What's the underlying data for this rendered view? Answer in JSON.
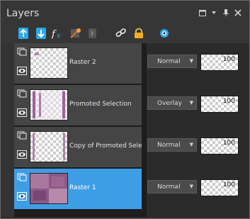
{
  "panel": {
    "title": "Layers"
  },
  "window_buttons": [
    "maximize-icon",
    "dropdown-icon",
    "pin-icon",
    "close-icon"
  ],
  "toolbar": {
    "icons": [
      "new-raster-layer-icon",
      "merge-down-icon",
      "fx-effects-icon",
      "mask-icon",
      "adjustment-icon",
      "link-icon",
      "lock-icon",
      "visibility-toggle-icon"
    ]
  },
  "layers": [
    {
      "name": "Raster 2",
      "blend_mode": "Normal",
      "opacity": "100",
      "selected": false
    },
    {
      "name": "Promoted Selection",
      "blend_mode": "Overlay",
      "opacity": "100",
      "selected": false
    },
    {
      "name": "Copy of Promoted Selection",
      "blend_mode": "Normal",
      "opacity": "100",
      "selected": false
    },
    {
      "name": "Raster 1",
      "blend_mode": "Normal",
      "opacity": "100",
      "selected": true
    }
  ],
  "colors": {
    "selected_row": "#3e9ee5",
    "row": "#454545",
    "panel_bg": "#2b2b2b"
  }
}
